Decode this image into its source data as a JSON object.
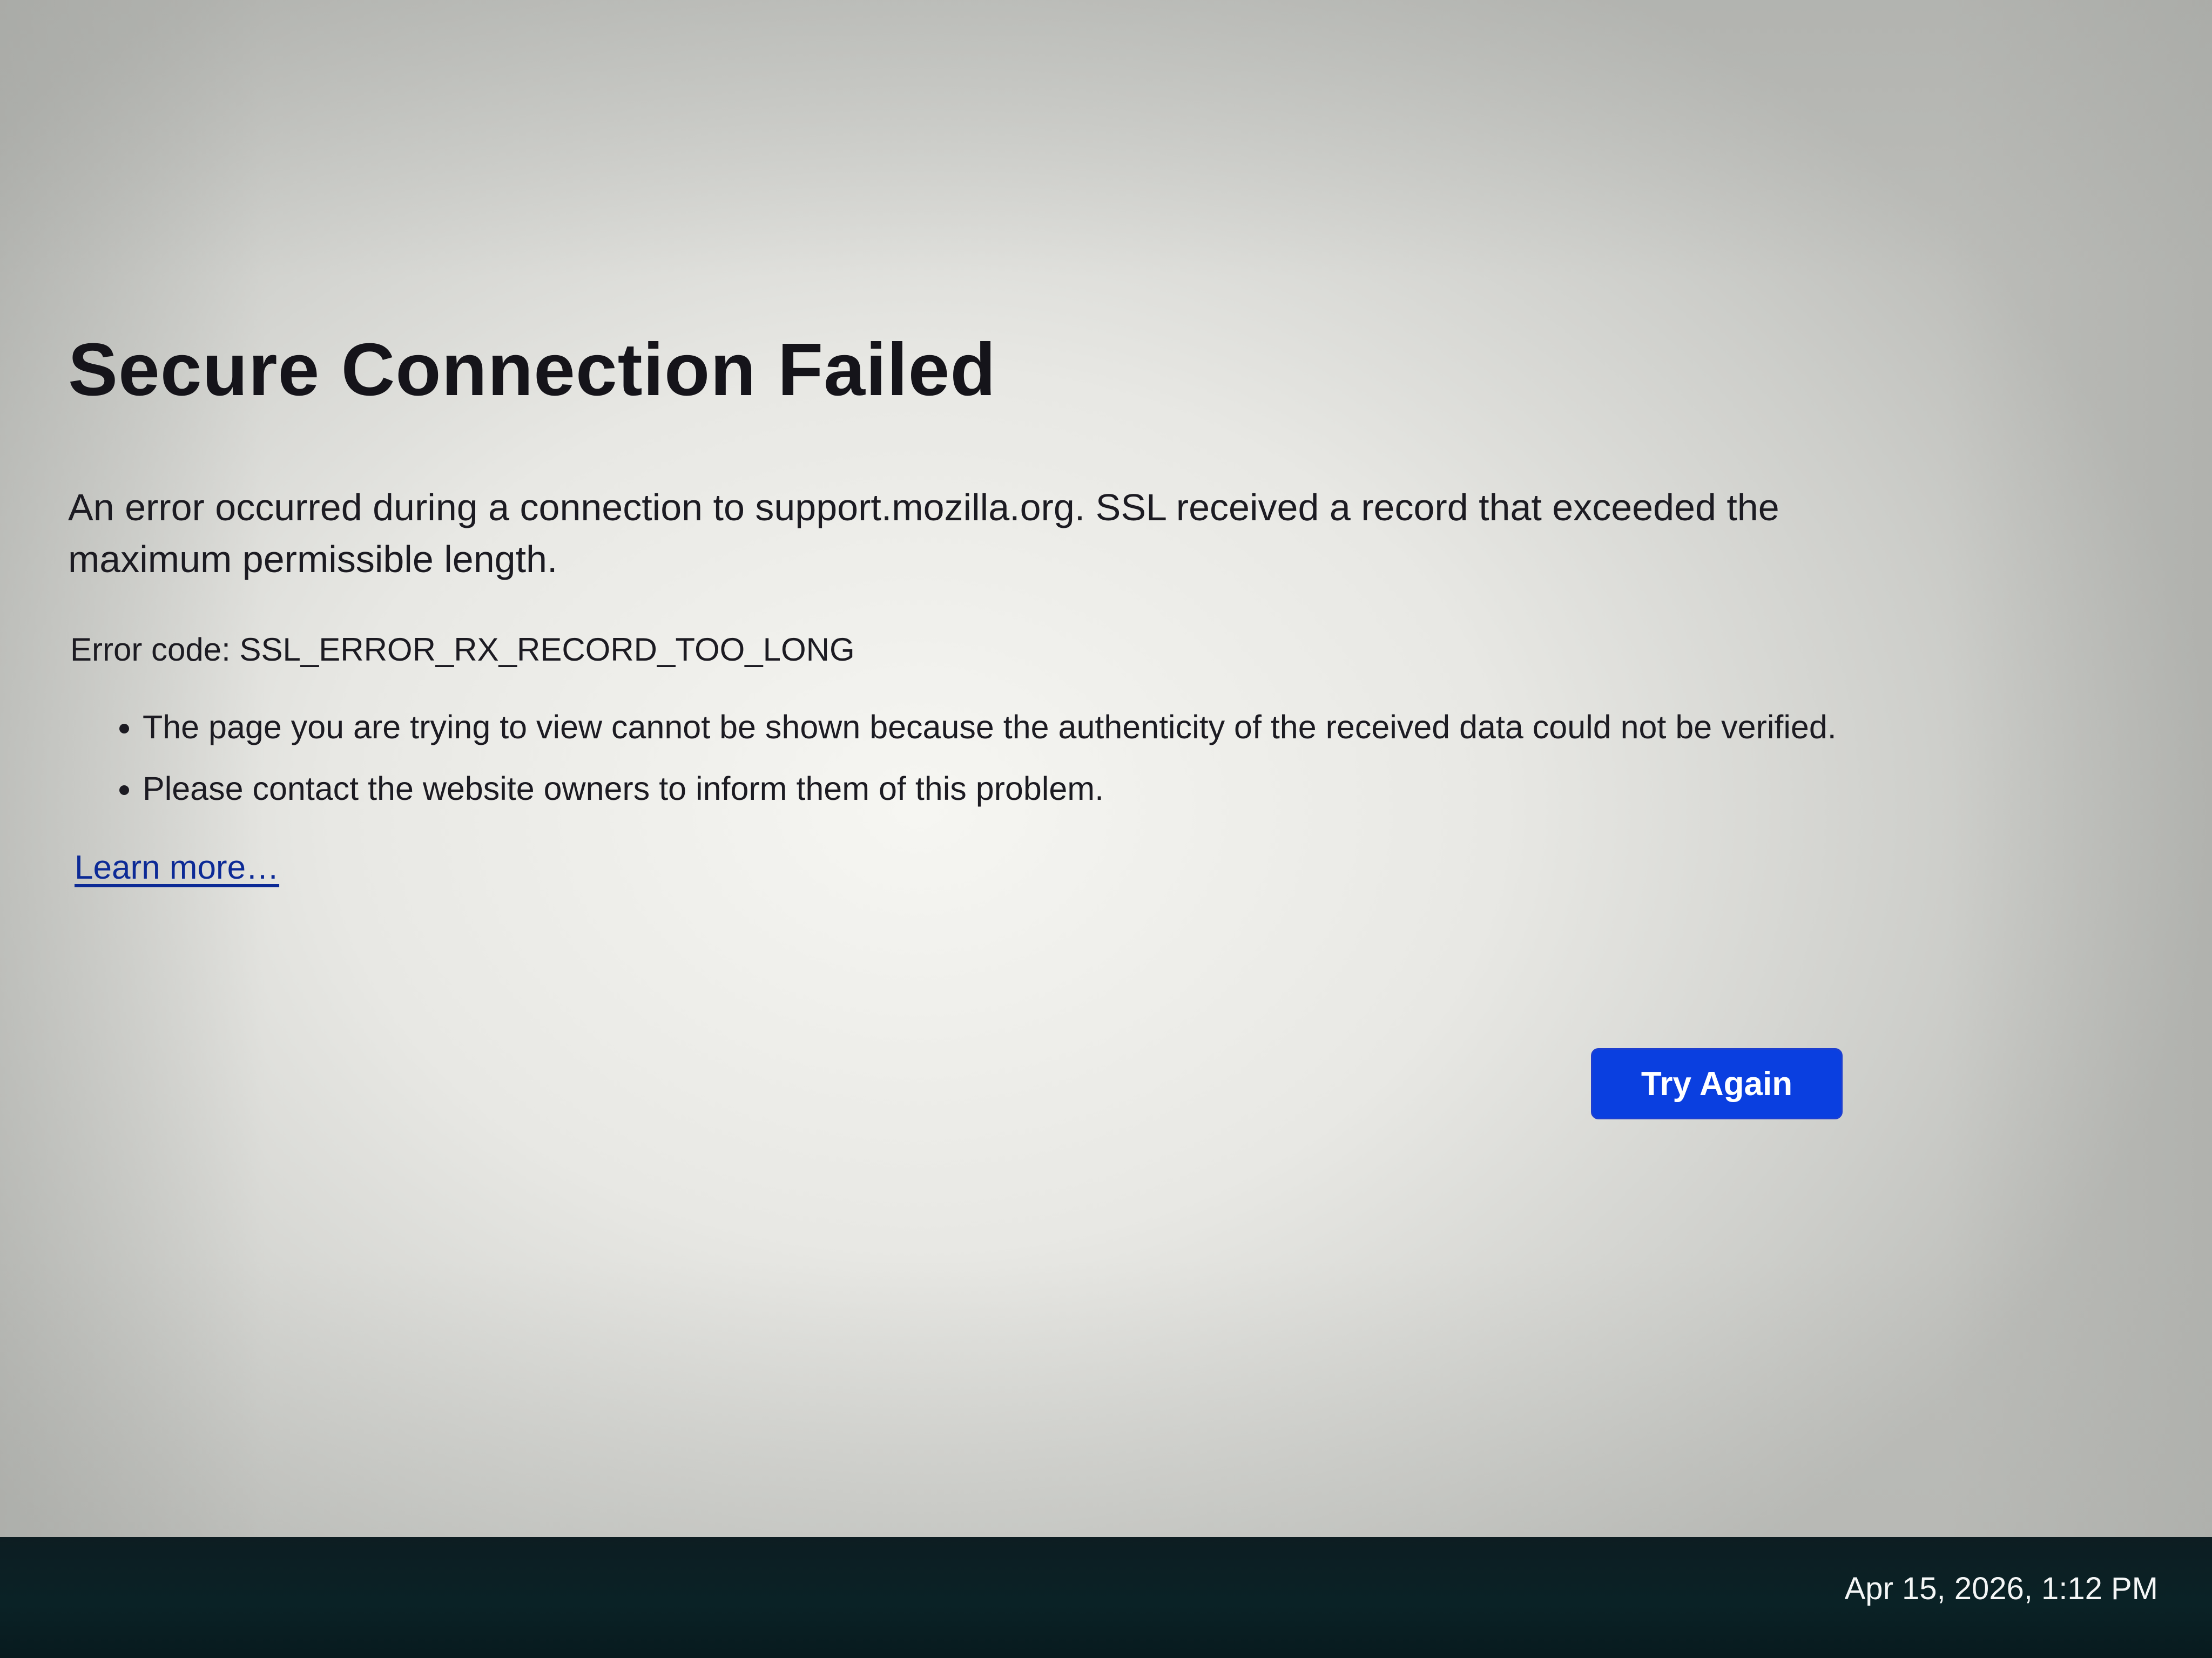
{
  "error_page": {
    "title": "Secure Connection Failed",
    "description": "An error occurred during a connection to support.mozilla.org. SSL received a record that exceeded the maximum permissible length.",
    "error_code": "Error code: SSL_ERROR_RX_RECORD_TOO_LONG",
    "bullets": [
      "The page you are trying to view cannot be shown because the authenticity of the received data could not be verified.",
      "Please contact the website owners to inform them of this problem."
    ],
    "learn_more_label": "Learn more…",
    "try_again_label": "Try Again"
  },
  "taskbar": {
    "clock": "Apr 15, 2026, 1:12 PM"
  },
  "colors": {
    "button_background": "#0a3fe0",
    "link": "#0c2a96",
    "taskbar_background": "#0a2226"
  }
}
